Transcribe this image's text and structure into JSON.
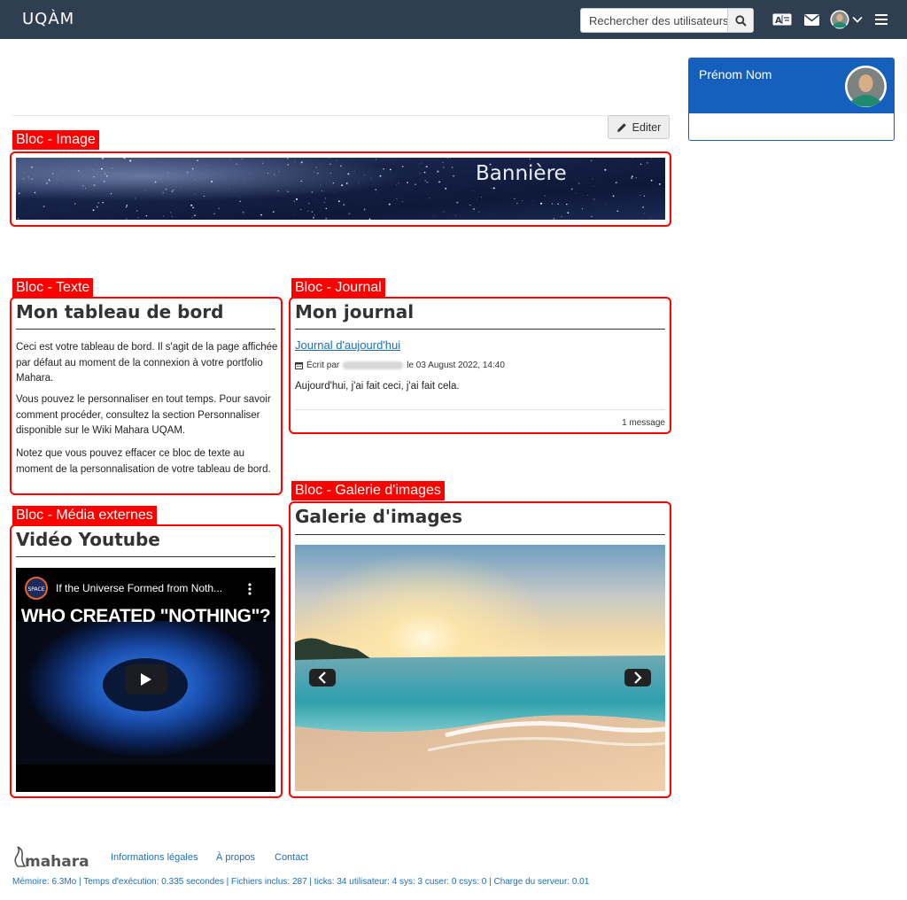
{
  "header": {
    "logo": "UQÀM",
    "search_placeholder": "Rechercher des utilisateurs"
  },
  "icons": {
    "search": "search-icon",
    "language": "language-icon",
    "mail": "mail-icon",
    "avatar": "avatar",
    "chevron": "chevron-down-icon",
    "menu": "hamburger-menu-icon"
  },
  "profile": {
    "name": "Prénom Nom"
  },
  "toolbar": {
    "edit_label": "Editer"
  },
  "tags": {
    "image": "Bloc - Image",
    "texte": "Bloc - Texte",
    "journal": "Bloc - Journal",
    "media": "Bloc - Média externes",
    "galerie": "Bloc - Galerie d'images"
  },
  "banner": {
    "text": "Bannière"
  },
  "text_block": {
    "title": "Mon tableau de bord",
    "paragraphs": [
      "Ceci est votre tableau de bord. Il s'agit de la page affichée par défaut au moment de la connexion à votre portfolio Mahara.",
      "Vous pouvez le personnaliser en tout temps. Pour savoir comment procéder, consultez la section Personnaliser disponible sur le Wiki Mahara UQAM.",
      "Notez que vous pouvez effacer ce bloc de texte au moment de la personnalisation de votre tableau de bord."
    ]
  },
  "journal": {
    "title": "Mon journal",
    "entry_title": "Journal d'aujourd'hui",
    "meta_prefix": "Écrit par",
    "meta_suffix": "le 03 August 2022, 14:40",
    "body": "Aujourd'hui, j'ai fait ceci, j'ai fait cela.",
    "count": "1 message"
  },
  "media": {
    "title": "Vidéo Youtube",
    "video_title": "If the Universe Formed from Noth...",
    "video_caption": "WHO CREATED \"NOTHING\"?",
    "channel_badge": "SPACE"
  },
  "gallery": {
    "title": "Galerie d'images"
  },
  "footer": {
    "powered_by": "mahara",
    "links": [
      "Informations légales",
      "À propos",
      "Contact"
    ],
    "stats": "Mémoire: 6.3Mo | Temps d'exécution: 0.335 secondes | Fichiers inclus: 287 | ticks: 34 utilisateur: 4 sys: 3 cuser: 0 csys: 0 | Charge du serveur: 0.01"
  },
  "colors": {
    "topbar": "#2f3e50",
    "profile_header": "#1560bd",
    "annotation": "#ff0000",
    "link": "#1b6fb8"
  }
}
